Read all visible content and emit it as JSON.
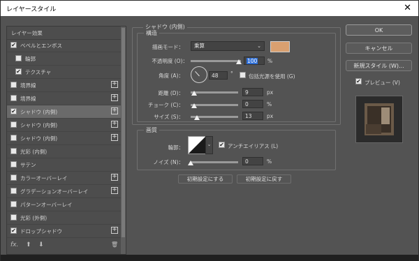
{
  "window": {
    "title": "レイヤースタイル",
    "close": "✕"
  },
  "effects": {
    "header": "レイヤー効果",
    "items": [
      {
        "label": "ベベルとエンボス",
        "checked": true,
        "plus": false
      },
      {
        "label": "輪郭",
        "checked": false,
        "plus": false
      },
      {
        "label": "テクスチャ",
        "checked": true,
        "plus": false
      },
      {
        "label": "境界線",
        "checked": false,
        "plus": true
      },
      {
        "label": "境界線",
        "checked": false,
        "plus": true
      },
      {
        "label": "シャドウ (内側)",
        "checked": true,
        "plus": true
      },
      {
        "label": "シャドウ (内側)",
        "checked": false,
        "plus": true
      },
      {
        "label": "シャドウ (内側)",
        "checked": false,
        "plus": true
      },
      {
        "label": "光彩 (内側)",
        "checked": false,
        "plus": false
      },
      {
        "label": "サテン",
        "checked": false,
        "plus": false
      },
      {
        "label": "カラーオーバーレイ",
        "checked": false,
        "plus": true
      },
      {
        "label": "グラデーションオーバーレイ",
        "checked": false,
        "plus": true
      },
      {
        "label": "パターンオーバーレイ",
        "checked": false,
        "plus": false
      },
      {
        "label": "光彩 (外側)",
        "checked": false,
        "plus": false
      },
      {
        "label": "ドロップシャドウ",
        "checked": true,
        "plus": true
      }
    ],
    "fx": "fx.",
    "up": "⬆",
    "down": "⬇",
    "trash": "🗑"
  },
  "shadow": {
    "section": "シャドウ (内側)",
    "structure": "構造",
    "blend_label": "描画モード：",
    "blend_value": "乗算",
    "opacity_label": "不透明度 (O)：",
    "opacity_value": "100",
    "angle_label": "角度 (A)：",
    "angle_value": "48",
    "degree": "°",
    "global_light": "包括光源を使用 (G)",
    "distance_label": "距離 (D)：",
    "distance_value": "9",
    "choke_label": "チョーク (C)：",
    "choke_value": "0",
    "size_label": "サイズ (S)：",
    "size_value": "13",
    "pct": "%",
    "px": "px",
    "quality": "画質",
    "contour_label": "輪郭：",
    "antialias": "アンチエイリアス (L)",
    "noise_label": "ノイズ (N)：",
    "noise_value": "0",
    "default_set": "初期設定にする",
    "default_reset": "初期設定に戻す",
    "shadow_color": "#d9a070"
  },
  "buttons": {
    "ok": "OK",
    "cancel": "キャンセル",
    "new_style": "新規スタイル (W)...",
    "preview": "プレビュー (V)"
  }
}
